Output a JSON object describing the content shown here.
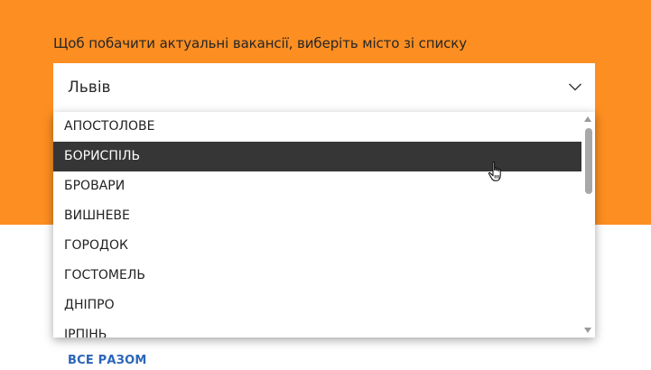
{
  "page": {
    "prompt_text": "Щоб побачити актуальні вакансії, виберіть місто зі списку",
    "accent_color": "#fd8e21",
    "link_color": "#2b65b8"
  },
  "city_select": {
    "selected_value": "Львів",
    "toggle_icon": "chevron-down-icon",
    "options": [
      {
        "label": "АПОСТОЛОВЕ",
        "highlighted": false
      },
      {
        "label": "БОРИСПІЛЬ",
        "highlighted": true
      },
      {
        "label": "БРОВАРИ",
        "highlighted": false
      },
      {
        "label": "ВИШНЕВЕ",
        "highlighted": false
      },
      {
        "label": "ГОРОДОК",
        "highlighted": false
      },
      {
        "label": "ГОСТОМЕЛЬ",
        "highlighted": false
      },
      {
        "label": "ДНІПРО",
        "highlighted": false
      },
      {
        "label": "ІРПІНЬ",
        "highlighted": false
      }
    ]
  },
  "footer_link": {
    "label": "ВСЕ РАЗОМ"
  },
  "pointer": {
    "icon": "hand-pointer-icon"
  }
}
